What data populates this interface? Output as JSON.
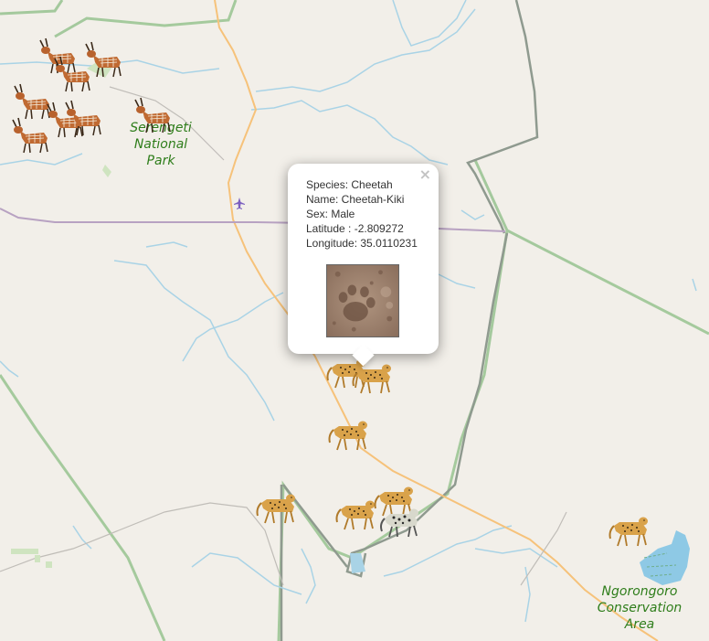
{
  "map": {
    "labels": {
      "serengeti": [
        "Serengeti",
        "National",
        "Park"
      ],
      "ngorongoro": [
        "Ngorongoro",
        "Conservation",
        "Area"
      ]
    },
    "colors": {
      "land": "#f2efe9",
      "park_border": "#8fbf85",
      "river": "#a9d3e6",
      "road": "#f6c27a",
      "border": "#b8a2c2",
      "lake": "#8ec9e5",
      "label": "#2e7d1a"
    },
    "markers": [
      {
        "species": "Bushbuck",
        "icon": "antelope-icon"
      },
      {
        "species": "Bushbuck",
        "icon": "antelope-icon"
      },
      {
        "species": "Bushbuck",
        "icon": "antelope-icon"
      },
      {
        "species": "Bushbuck",
        "icon": "antelope-icon"
      },
      {
        "species": "Bushbuck",
        "icon": "antelope-icon"
      },
      {
        "species": "Bushbuck",
        "icon": "antelope-icon"
      },
      {
        "species": "Bushbuck",
        "icon": "antelope-icon"
      },
      {
        "species": "Bushbuck",
        "icon": "antelope-icon"
      },
      {
        "species": "Cheetah",
        "icon": "cheetah-icon"
      },
      {
        "species": "Cheetah",
        "icon": "cheetah-icon"
      },
      {
        "species": "Cheetah",
        "icon": "cheetah-icon"
      },
      {
        "species": "Cheetah",
        "icon": "cheetah-icon"
      },
      {
        "species": "Cheetah",
        "icon": "cheetah-icon"
      },
      {
        "species": "Cheetah",
        "icon": "cheetah-icon"
      },
      {
        "species": "Leopard",
        "icon": "leopard-icon"
      },
      {
        "species": "Cheetah",
        "icon": "cheetah-icon"
      }
    ]
  },
  "popup": {
    "close_symbol": "×",
    "lines": [
      "Species: Cheetah",
      "Name: Cheetah-Kiki",
      "Sex: Male",
      "Latitude : -2.809272",
      "Longitude: 35.0110231"
    ],
    "photo_icon": "paw-print-photo"
  }
}
